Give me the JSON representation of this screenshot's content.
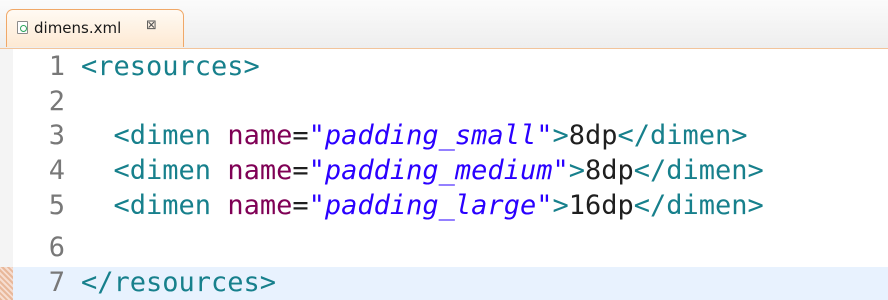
{
  "tab": {
    "file_name": "dimens.xml",
    "close_glyph": "⊠",
    "file_icon": "xml-file-icon",
    "close_icon": "close-icon"
  },
  "colors": {
    "tag": "#17808c",
    "attribute": "#7f0055",
    "value": "#2a00ff",
    "line_number": "#787878",
    "current_line_bg": "#e8f2fe",
    "active_tab_border": "#f0a868"
  },
  "editor": {
    "current_line": 7,
    "lines": [
      {
        "num": "1",
        "tokens": [
          [
            "tag",
            "<resources>"
          ]
        ]
      },
      {
        "num": "2",
        "tokens": []
      },
      {
        "num": "3",
        "tokens": [
          [
            "punct",
            "  "
          ],
          [
            "tag",
            "<dimen"
          ],
          [
            "punct",
            " "
          ],
          [
            "attr",
            "name"
          ],
          [
            "punct",
            "="
          ],
          [
            "val",
            "\"padding_small\""
          ],
          [
            "tag",
            ">"
          ],
          [
            "text",
            "8dp"
          ],
          [
            "tag",
            "</dimen>"
          ]
        ]
      },
      {
        "num": "4",
        "tokens": [
          [
            "punct",
            "  "
          ],
          [
            "tag",
            "<dimen"
          ],
          [
            "punct",
            " "
          ],
          [
            "attr",
            "name"
          ],
          [
            "punct",
            "="
          ],
          [
            "val",
            "\"padding_medium\""
          ],
          [
            "tag",
            ">"
          ],
          [
            "text",
            "8dp"
          ],
          [
            "tag",
            "</dimen>"
          ]
        ]
      },
      {
        "num": "5",
        "tokens": [
          [
            "punct",
            "  "
          ],
          [
            "tag",
            "<dimen"
          ],
          [
            "punct",
            " "
          ],
          [
            "attr",
            "name"
          ],
          [
            "punct",
            "="
          ],
          [
            "val",
            "\"padding_large\""
          ],
          [
            "tag",
            ">"
          ],
          [
            "text",
            "16dp"
          ],
          [
            "tag",
            "</dimen>"
          ]
        ]
      },
      {
        "num": "6",
        "tokens": []
      },
      {
        "num": "7",
        "tokens": [
          [
            "tag",
            "</resources>"
          ]
        ]
      }
    ]
  }
}
